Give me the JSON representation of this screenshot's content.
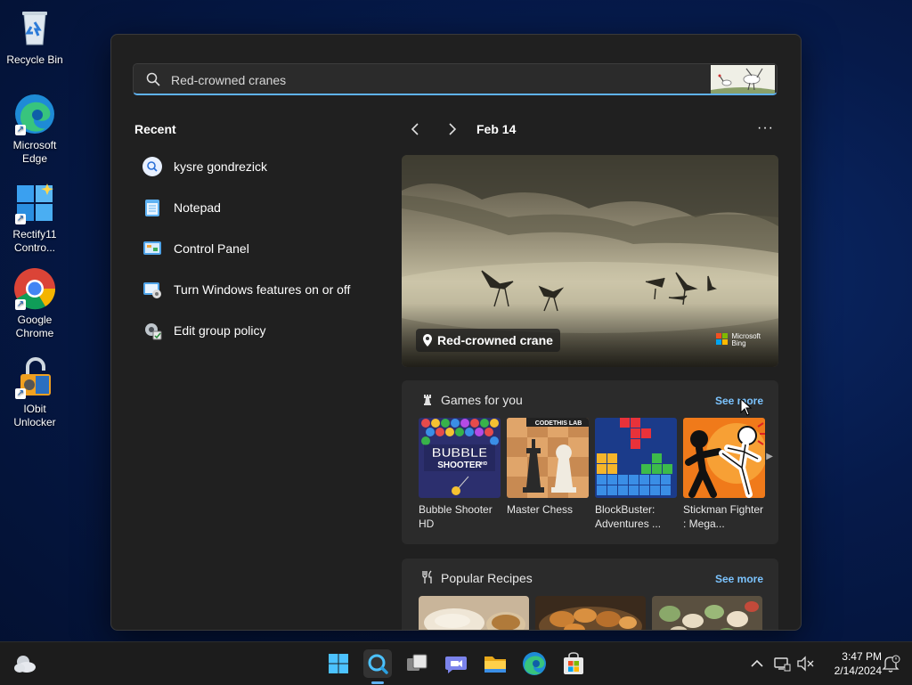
{
  "desktop": {
    "icons": [
      {
        "label": "Recycle Bin"
      },
      {
        "label": "Microsoft Edge"
      },
      {
        "label": "Rectify11 Contro..."
      },
      {
        "label": "Google Chrome"
      },
      {
        "label": "IObit Unlocker"
      }
    ]
  },
  "search": {
    "value": "Red-crowned cranes",
    "placeholder": "Red-crowned cranes"
  },
  "recent": {
    "heading": "Recent",
    "items": [
      {
        "label": "kysre gondrezick",
        "icon": "search-icon"
      },
      {
        "label": "Notepad",
        "icon": "notepad-icon"
      },
      {
        "label": "Control Panel",
        "icon": "control-panel-icon"
      },
      {
        "label": "Turn Windows features on or off",
        "icon": "windows-features-icon"
      },
      {
        "label": "Edit group policy",
        "icon": "group-policy-icon"
      }
    ]
  },
  "highlights": {
    "date": "Feb 14",
    "more": "···",
    "hero_caption": "Red-crowned crane",
    "bing_line1": "Microsoft",
    "bing_line2": "Bing"
  },
  "games": {
    "title": "Games for you",
    "see_more": "See more",
    "badge": "CODETHIS LAB",
    "bubble_line1": "BUBBLE",
    "bubble_line2": "SHOOTER",
    "bubble_line3": "HD",
    "items": [
      {
        "name": "Bubble Shooter HD"
      },
      {
        "name": "Master Chess"
      },
      {
        "name": "BlockBuster: Adventures ..."
      },
      {
        "name": "Stickman Fighter : Mega..."
      }
    ]
  },
  "recipes": {
    "title": "Popular Recipes",
    "see_more": "See more"
  },
  "taskbar": {
    "time": "3:47 PM",
    "date": "2/14/2024"
  },
  "colors": {
    "accent": "#5fb2f2",
    "link": "#7cc4ff",
    "panel": "#202020",
    "card": "#2b2b2b"
  }
}
